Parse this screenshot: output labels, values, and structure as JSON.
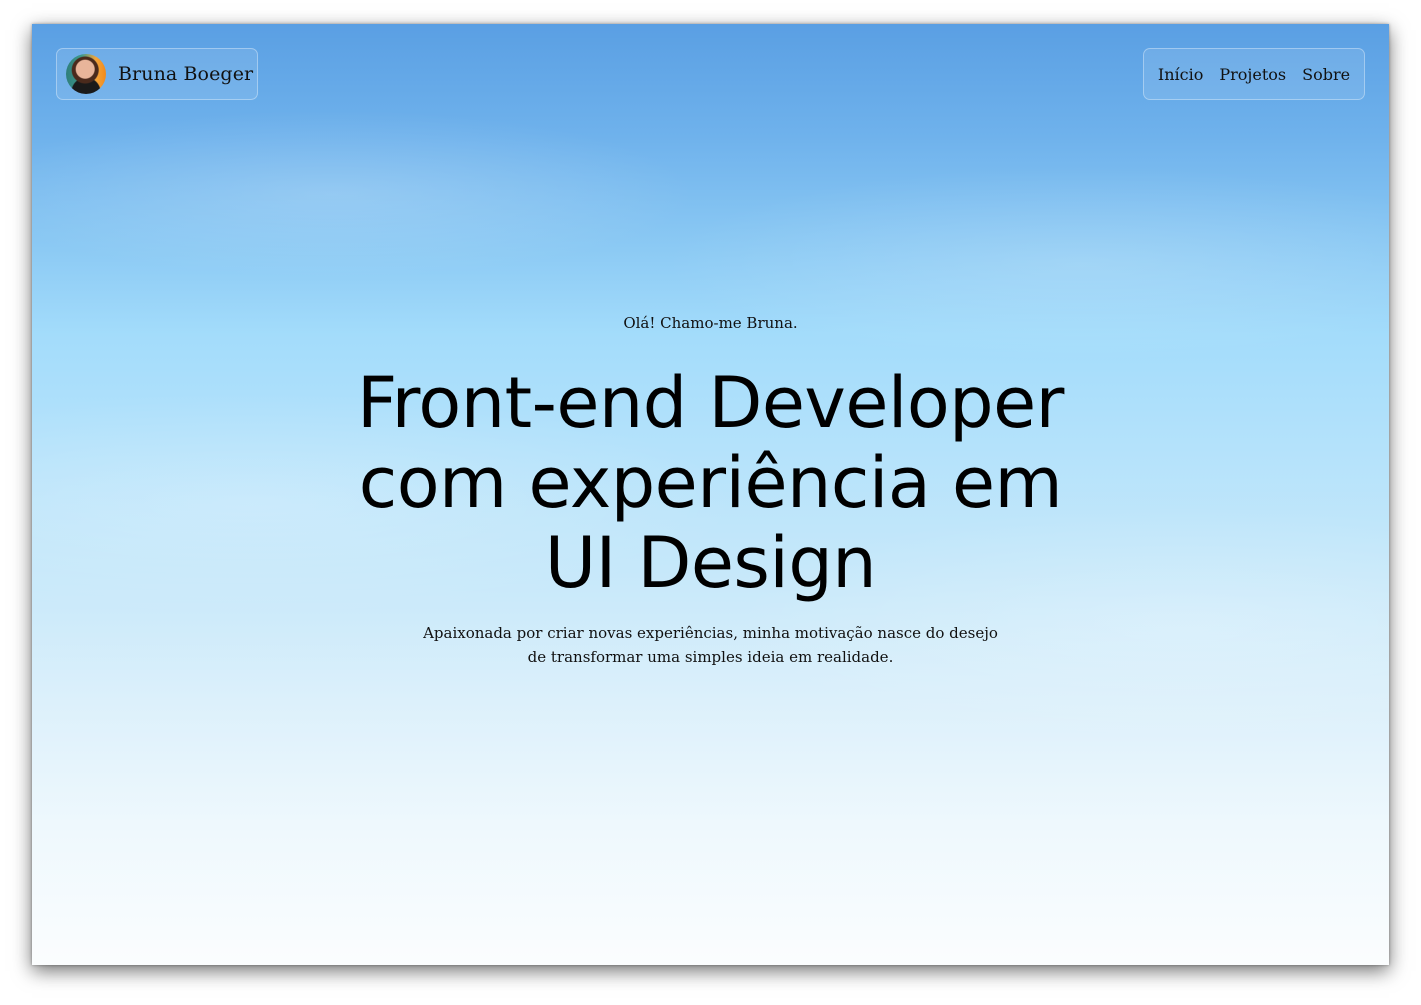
{
  "header": {
    "brand_name": "Bruna Boeger",
    "avatar_alt": "Bruna Boeger",
    "nav": [
      {
        "label": "Início"
      },
      {
        "label": "Projetos"
      },
      {
        "label": "Sobre"
      }
    ]
  },
  "hero": {
    "greeting": "Olá! Chamo-me Bruna.",
    "headline_lines": [
      "Front-end Developer",
      "com experiência em",
      "UI Design"
    ],
    "subtitle_lines": [
      "Apaixonada por criar novas experiências, minha motivação nasce do desejo",
      "de transformar uma simples ideia em realidade."
    ]
  },
  "colors": {
    "sky_top": "#5a9fe3",
    "sky_mid": "#a3dcfb",
    "sky_bottom": "#fbfdfe",
    "text": "#111111"
  }
}
